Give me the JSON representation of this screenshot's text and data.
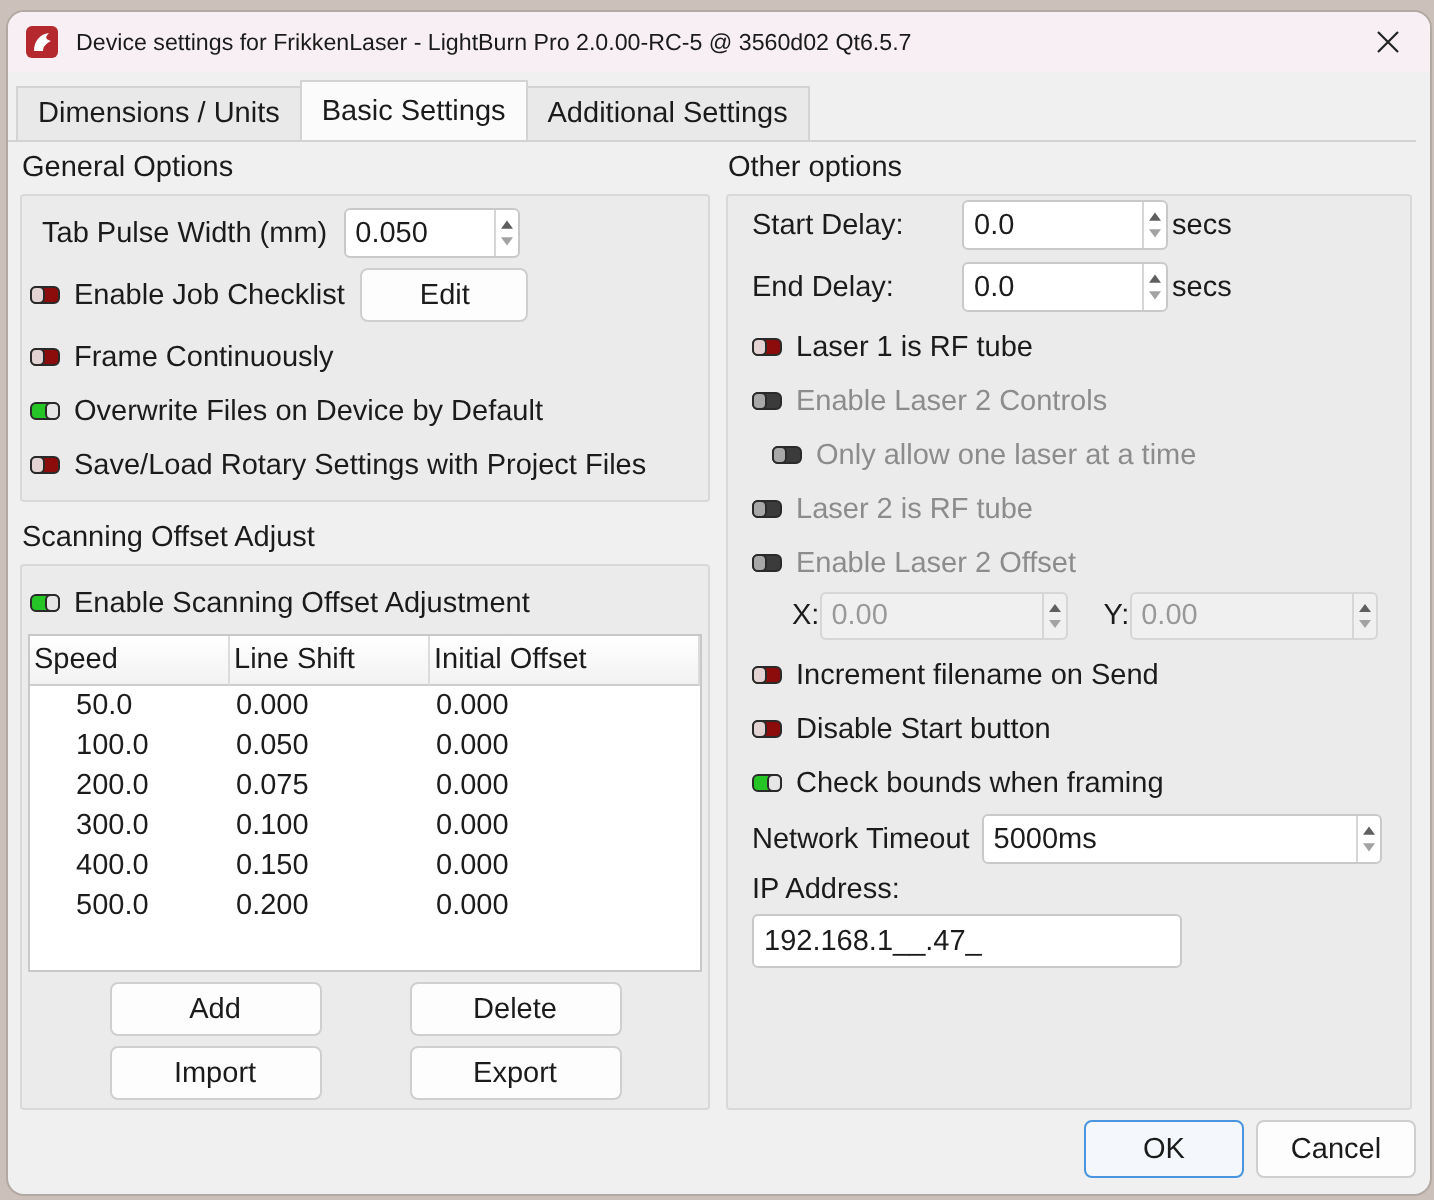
{
  "window": {
    "title": "Device settings for FrikkenLaser - LightBurn Pro 2.0.00-RC-5 @ 3560d02 Qt6.5.7"
  },
  "tabs": [
    {
      "label": "Dimensions / Units",
      "selected": false
    },
    {
      "label": "Basic Settings",
      "selected": true
    },
    {
      "label": "Additional Settings",
      "selected": false
    }
  ],
  "general_options": {
    "title": "General Options",
    "rows": [
      {
        "kind": "spin",
        "label": "Tab Pulse Width (mm)",
        "value": "0.050"
      },
      {
        "kind": "toggle",
        "label": "Enable Job Checklist",
        "on": false,
        "button": "Edit"
      },
      {
        "kind": "toggle",
        "label": "Frame Continuously",
        "on": false
      },
      {
        "kind": "toggle",
        "label": "Overwrite Files on Device by Default",
        "on": true
      },
      {
        "kind": "toggle",
        "label": "Save/Load Rotary Settings with Project Files",
        "on": false
      }
    ]
  },
  "scanning_offset": {
    "title": "Scanning Offset Adjust",
    "toggle": {
      "label": "Enable Scanning Offset Adjustment",
      "on": true
    },
    "table": {
      "columns": [
        "Speed",
        "Line Shift",
        "Initial Offset"
      ],
      "rows": [
        [
          "50.0",
          "0.000",
          "0.000"
        ],
        [
          "100.0",
          "0.050",
          "0.000"
        ],
        [
          "200.0",
          "0.075",
          "0.000"
        ],
        [
          "300.0",
          "0.100",
          "0.000"
        ],
        [
          "400.0",
          "0.150",
          "0.000"
        ],
        [
          "500.0",
          "0.200",
          "0.000"
        ]
      ]
    },
    "buttons": [
      "Add",
      "Delete",
      "Import",
      "Export"
    ]
  },
  "other_options": {
    "title": "Other options",
    "rows": [
      {
        "kind": "spin",
        "label": "Start Delay:",
        "value": "0.0",
        "unit": "secs",
        "disabled": false
      },
      {
        "kind": "spin",
        "label": "End Delay:",
        "value": "0.0",
        "unit": "secs",
        "disabled": false
      },
      {
        "kind": "toggle",
        "label": "Laser 1 is RF tube",
        "on": false,
        "disabled": false
      },
      {
        "kind": "toggle",
        "label": "Enable Laser 2 Controls",
        "on": false,
        "disabled": true,
        "children": [
          {
            "kind": "toggle",
            "label": "Only allow one laser at a time",
            "on": false,
            "disabled": true
          }
        ]
      },
      {
        "kind": "toggle",
        "label": "Laser 2 is RF tube",
        "on": false,
        "disabled": true
      },
      {
        "kind": "toggle",
        "label": "Enable Laser 2 Offset",
        "on": false,
        "disabled": true
      },
      {
        "kind": "xy",
        "disabled": true,
        "fields": [
          {
            "label": "X:",
            "value": "0.00"
          },
          {
            "label": "Y:",
            "value": "0.00"
          }
        ]
      },
      {
        "kind": "toggle",
        "label": "Increment filename on Send",
        "on": false,
        "disabled": false
      },
      {
        "kind": "toggle",
        "label": "Disable Start button",
        "on": false,
        "disabled": false
      },
      {
        "kind": "toggle",
        "label": "Check bounds when framing",
        "on": true,
        "disabled": false
      },
      {
        "kind": "spin_wide",
        "label": "Network Timeout",
        "value": "5000ms",
        "disabled": false
      },
      {
        "kind": "text_field",
        "label": "IP Address:",
        "value": "192.168.1__.47_",
        "disabled": false
      }
    ]
  },
  "footer": {
    "buttons": [
      {
        "label": "OK",
        "default": true
      },
      {
        "label": "Cancel",
        "default": false
      }
    ]
  }
}
